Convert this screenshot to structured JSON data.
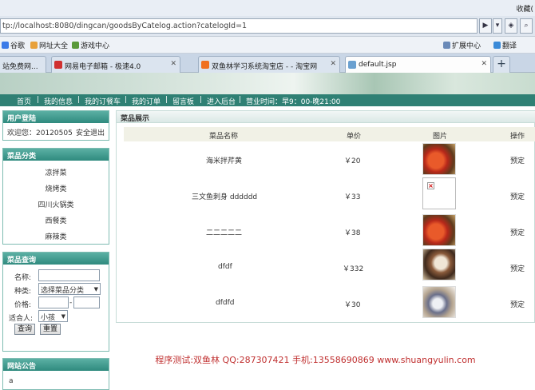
{
  "browser": {
    "favorites_label": "收藏(",
    "url": "tp://localhost:8080/dingcan/goodsByCatelog.action?catelogId=1",
    "bookmarks": [
      {
        "label": "谷歌",
        "color": "#3b7be8"
      },
      {
        "label": "网址大全",
        "color": "#e8a13b"
      },
      {
        "label": "游戏中心",
        "color": "#5a9a3a"
      }
    ],
    "extensions_label": "扩展中心",
    "translate_label": "翻译",
    "tabs": [
      {
        "label": "站免费网...",
        "color": "#d04030"
      },
      {
        "label": "网易电子邮箱 - 极速4.0",
        "color": "#d03030"
      },
      {
        "label": "双鱼林学习系统淘宝店 - - 淘宝网",
        "color": "#f07020"
      },
      {
        "label": "default.jsp",
        "color": "#6aa0d0"
      }
    ]
  },
  "menu": [
    "首页",
    "|",
    "我的信息",
    "|",
    "我的订餐车",
    "|",
    "我的订单",
    "|",
    "留言板",
    "|",
    "进入后台",
    "|",
    "营业时间：早9：00-晚21:00"
  ],
  "login": {
    "title": "用户登陆",
    "welcome": "欢迎您：20120505",
    "logout": "安全退出"
  },
  "categories": {
    "title": "菜品分类",
    "items": [
      "凉拌菜",
      "烧烤类",
      "四川火锅类",
      "西餐类",
      "麻辣类"
    ]
  },
  "search": {
    "title": "菜品查询",
    "name_label": "名称:",
    "type_label": "种类:",
    "type_value": "选择菜品分类",
    "price_label": "价格:",
    "price_sep": "-",
    "fit_label": "适合人:",
    "fit_value": "小孩",
    "query_button": "查询",
    "reset_button": "重置"
  },
  "notice": {
    "title": "网站公告",
    "text": "a"
  },
  "dishes": {
    "title": "菜品展示",
    "headers": [
      "菜品名称",
      "单价",
      "图片",
      "操作"
    ],
    "rows": [
      {
        "name": "海米拌芹黄",
        "price": "￥20",
        "image": "food1",
        "action": "预定"
      },
      {
        "name": "三文鱼刺身  dddddd",
        "price": "￥33",
        "image": "broken",
        "action": "预定"
      },
      {
        "name": "二二二二二",
        "price": "￥38",
        "image": "food1",
        "action": "预定"
      },
      {
        "name": "dfdf",
        "price": "￥332",
        "image": "food2",
        "action": "预定"
      },
      {
        "name": "dfdfd",
        "price": "￥30",
        "image": "food3",
        "action": "预定"
      }
    ]
  },
  "footer": "程序测试:双鱼林 QQ:287307421 手机:13558690869 www.shuangyulin.com"
}
